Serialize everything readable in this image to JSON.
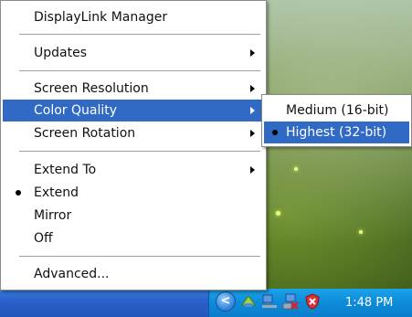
{
  "menu": {
    "title": "DisplayLink Manager",
    "updates": "Updates",
    "screen_resolution": "Screen Resolution",
    "color_quality": "Color Quality",
    "screen_rotation": "Screen Rotation",
    "extend_to": "Extend To",
    "extend": "Extend",
    "mirror": "Mirror",
    "off": "Off",
    "advanced": "Advanced..."
  },
  "submenu": {
    "medium": "Medium (16-bit)",
    "highest": "Highest (32-bit)"
  },
  "taskbar": {
    "clock": "1:48 PM",
    "chevron": "<",
    "tray_icons": [
      "tray-app-icon",
      "network-icon",
      "network-disconnected-icon",
      "security-shield-icon"
    ]
  },
  "colors": {
    "highlight": "#316ac5",
    "taskbar": "#2a5fc8",
    "tray": "#0d8bd8"
  }
}
